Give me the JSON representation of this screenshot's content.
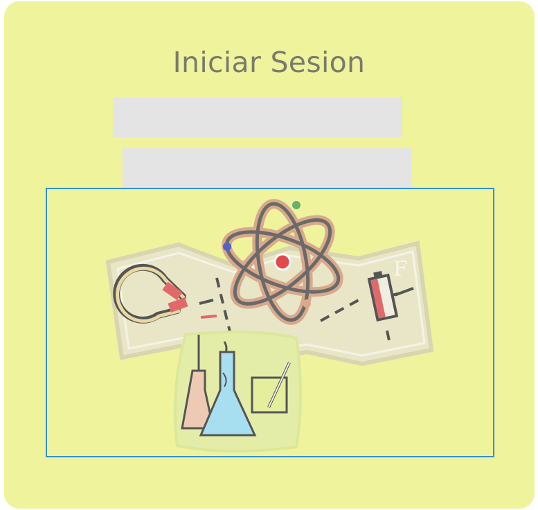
{
  "login": {
    "title": "Iniciar Sesion",
    "username_value": "",
    "password_value": ""
  },
  "illustration": {
    "description_icons": [
      "magnet-icon",
      "atom-icon",
      "battery-icon",
      "flask-icon",
      "beaker-icon"
    ],
    "letter_mark": "F"
  },
  "colors": {
    "card_background": "#eef39c",
    "field_background": "#e4e4e4",
    "frame_border": "#2f8fd8",
    "title_text": "#7a7a6e"
  }
}
